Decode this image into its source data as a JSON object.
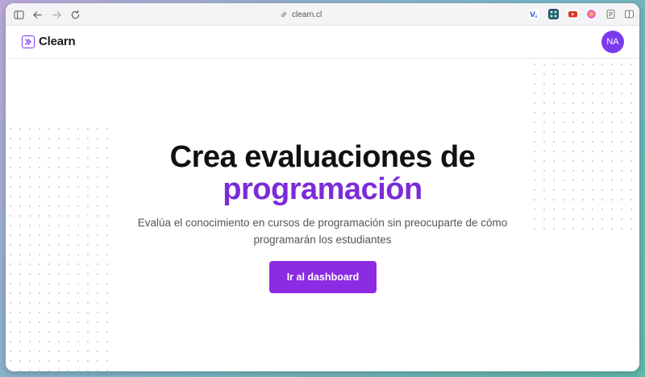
{
  "browser": {
    "url": "clearn.cl",
    "icons": [
      "sidebar-icon",
      "back-icon",
      "forward-icon",
      "reload-icon",
      "link-icon"
    ],
    "extensions": [
      {
        "name": "translate-extension-icon",
        "color": "#3a6fd8"
      },
      {
        "name": "grid-extension-icon",
        "color": "#2b4a6b"
      },
      {
        "name": "youtube-extension-icon",
        "color": "#e0342b"
      },
      {
        "name": "color-extension-icon",
        "color": "#e86ac0"
      },
      {
        "name": "reader-icon",
        "color": "#777777"
      },
      {
        "name": "split-view-icon",
        "color": "#777777"
      }
    ]
  },
  "header": {
    "logo_text": "Clearn",
    "avatar_initials": "NA"
  },
  "hero": {
    "headline": "Crea evaluaciones de",
    "headline_accent": "programación",
    "subtitle": "Evalúa el conocimiento en cursos de programación sin preocuparte de cómo programarán los estudiantes",
    "cta_label": "Ir al dashboard"
  },
  "colors": {
    "accent": "#7c2bd9",
    "button": "#8b2be2"
  }
}
